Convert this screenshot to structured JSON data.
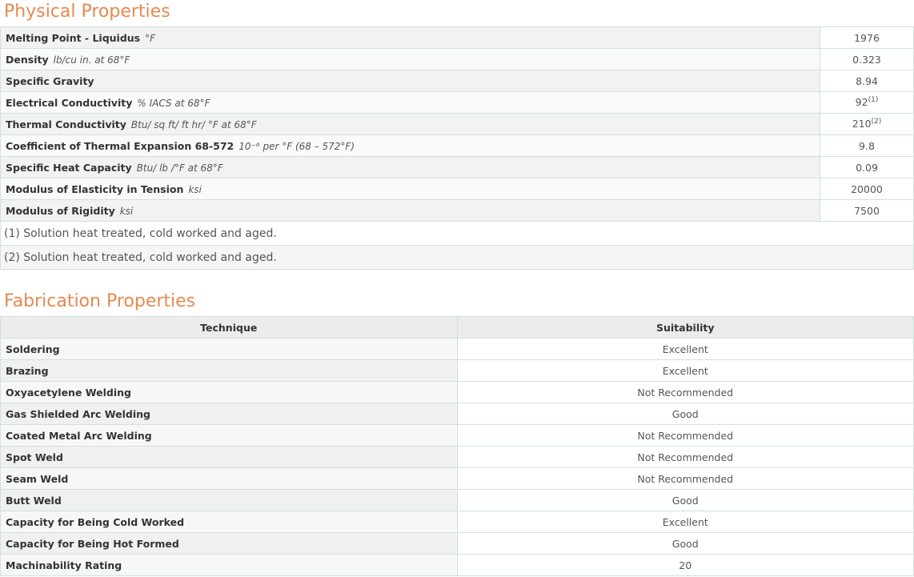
{
  "physical": {
    "title": "Physical Properties",
    "rows": [
      {
        "label": "Melting Point - Liquidus",
        "unit": "°F",
        "value": "1976",
        "sup": ""
      },
      {
        "label": "Density",
        "unit": "lb/cu in. at 68°F",
        "value": "0.323",
        "sup": ""
      },
      {
        "label": "Specific Gravity",
        "unit": "",
        "value": "8.94",
        "sup": ""
      },
      {
        "label": "Electrical Conductivity",
        "unit": "% IACS at 68°F",
        "value": "92",
        "sup": "(1)"
      },
      {
        "label": "Thermal Conductivity",
        "unit": "Btu/ sq ft/ ft hr/ °F at 68°F",
        "value": "210",
        "sup": "(2)"
      },
      {
        "label": "Coefficient of Thermal Expansion 68-572",
        "unit": "10⁻⁶ per °F (68 – 572°F)",
        "value": "9.8",
        "sup": ""
      },
      {
        "label": "Specific Heat Capacity",
        "unit": "Btu/ lb /°F at 68°F",
        "value": "0.09",
        "sup": ""
      },
      {
        "label": "Modulus of Elasticity in Tension",
        "unit": "ksi",
        "value": "20000",
        "sup": ""
      },
      {
        "label": "Modulus of Rigidity",
        "unit": "ksi",
        "value": "7500",
        "sup": ""
      }
    ],
    "notes": [
      "(1) Solution heat treated, cold worked and aged.",
      "(2) Solution heat treated, cold worked and aged."
    ]
  },
  "fabrication": {
    "title": "Fabrication Properties",
    "headers": {
      "technique": "Technique",
      "suitability": "Suitability"
    },
    "rows": [
      {
        "technique": "Soldering",
        "suitability": "Excellent"
      },
      {
        "technique": "Brazing",
        "suitability": "Excellent"
      },
      {
        "technique": "Oxyacetylene Welding",
        "suitability": "Not Recommended"
      },
      {
        "technique": "Gas Shielded Arc Welding",
        "suitability": "Good"
      },
      {
        "technique": "Coated Metal Arc Welding",
        "suitability": "Not Recommended"
      },
      {
        "technique": "Spot Weld",
        "suitability": "Not Recommended"
      },
      {
        "technique": "Seam Weld",
        "suitability": "Not Recommended"
      },
      {
        "technique": "Butt Weld",
        "suitability": "Good"
      },
      {
        "technique": "Capacity for Being Cold Worked",
        "suitability": "Excellent"
      },
      {
        "technique": "Capacity for Being Hot Formed",
        "suitability": "Good"
      },
      {
        "technique": "Machinability Rating",
        "suitability": "20"
      }
    ]
  },
  "colors": {
    "title_accent": "#e8884f",
    "border": "#cfe2de"
  }
}
